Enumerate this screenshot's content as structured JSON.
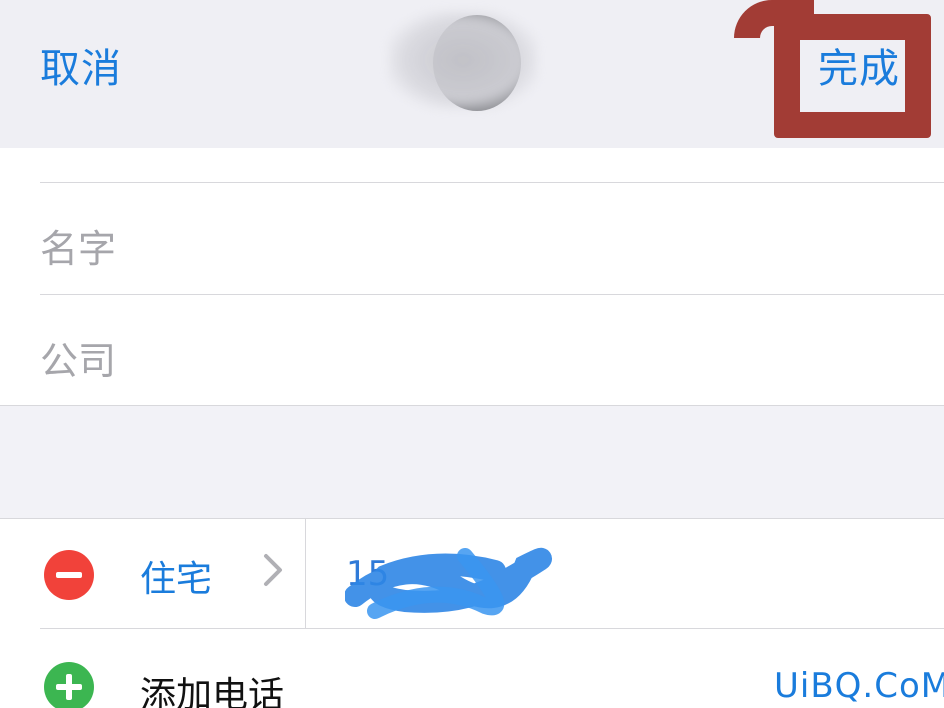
{
  "nav": {
    "cancel_label": "取消",
    "done_label": "完成"
  },
  "form": {
    "name_placeholder": "名字",
    "company_placeholder": "公司"
  },
  "phone": {
    "label": "住宅",
    "value_visible_prefix": "15",
    "add_label": "添加电话"
  },
  "watermark": "UiBQ.CoM",
  "colors": {
    "accent": "#1a7cdc",
    "remove": "#f1423a",
    "add": "#3cb651",
    "annotation": "#a23c35"
  }
}
